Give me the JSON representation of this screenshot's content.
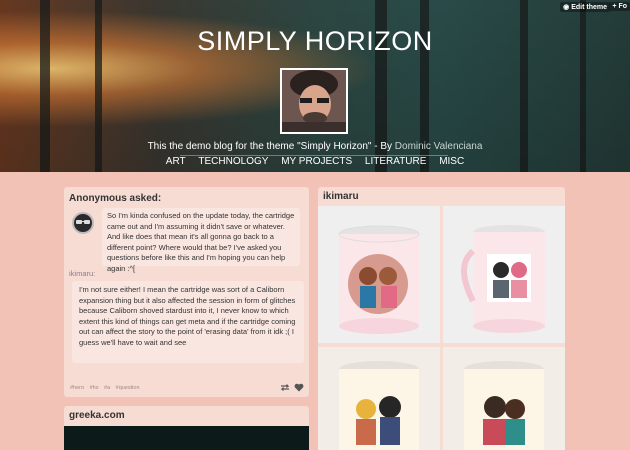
{
  "toolbar": {
    "edit_theme": "Edit theme",
    "follow": "+ Fo"
  },
  "header": {
    "title": "SIMPLY HORIZON",
    "description_prefix": "This the demo blog for the theme \"Simply Horizon\" - By ",
    "author": "Dominic Valenciana",
    "nav": [
      "ART",
      "TECHNOLOGY",
      "MY PROJECTS",
      "LITERATURE",
      "MISC"
    ]
  },
  "ask_post": {
    "title": "Anonymous asked:",
    "question": "So I'm kinda confused on the update today, the cartridge came out and I'm assuming it didn't save or whatever. And like does that mean it's all gonna go back to a different point? Where would that be? I've asked you questions before like this and I'm hoping you can help again :^[",
    "answerer": "ikimaru",
    "answer": "I'm not sure either! I mean the cartridge was sort of a Caliborn expansion thing but it also affected the session in form of glitches because Caliborn shoved stardust into it, I never know to which extent this kind of things can get meta and if the cartridge coming out can affect the story to the point of 'erasing data' from it idk ;( I guess we'll have to wait and see",
    "tags": [
      "#hero",
      "#hs",
      "#a",
      "#question"
    ]
  },
  "link_post": {
    "title": "greeka.com"
  },
  "photo_post": {
    "title": "ikimaru"
  },
  "colors": {
    "background": "#f3c2b7",
    "card": "#f7dcd4",
    "inner_box": "#fae6e0",
    "author_link": "#c6d4d0"
  }
}
